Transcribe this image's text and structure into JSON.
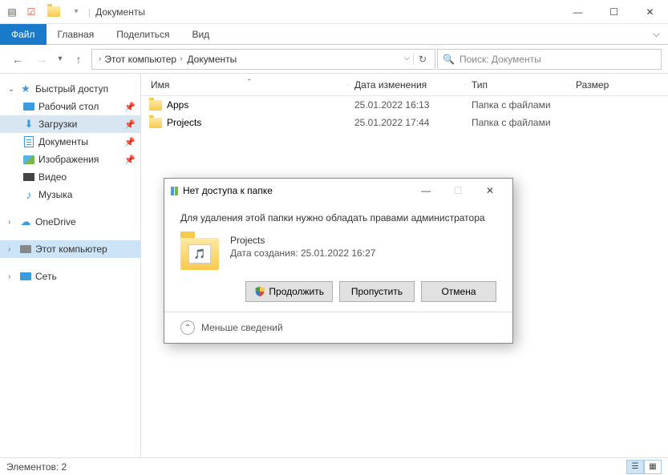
{
  "window": {
    "title": "Документы",
    "min": "—",
    "max": "☐",
    "close": "✕"
  },
  "ribbon": {
    "file": "Файл",
    "tabs": [
      "Главная",
      "Поделиться",
      "Вид"
    ]
  },
  "nav": {
    "this_pc": "Этот компьютер",
    "folder": "Документы",
    "search_placeholder": "Поиск: Документы"
  },
  "sidebar": {
    "quick": "Быстрый доступ",
    "items": [
      {
        "label": "Рабочий стол",
        "pinned": true
      },
      {
        "label": "Загрузки",
        "pinned": true,
        "selected": true
      },
      {
        "label": "Документы",
        "pinned": true
      },
      {
        "label": "Изображения",
        "pinned": true
      },
      {
        "label": "Видео"
      },
      {
        "label": "Музыка"
      }
    ],
    "onedrive": "OneDrive",
    "thispc": "Этот компьютер",
    "network": "Сеть"
  },
  "columns": {
    "name": "Имя",
    "date": "Дата изменения",
    "type": "Тип",
    "size": "Размер"
  },
  "files": [
    {
      "name": "Apps",
      "date": "25.01.2022 16:13",
      "type": "Папка с файлами"
    },
    {
      "name": "Projects",
      "date": "25.01.2022 17:44",
      "type": "Папка с файлами"
    }
  ],
  "status": {
    "count": "Элементов: 2"
  },
  "dialog": {
    "title": "Нет доступа к папке",
    "message": "Для удаления этой папки нужно обладать правами администратора",
    "item_name": "Projects",
    "item_date": "Дата создания: 25.01.2022 16:27",
    "btn_continue": "Продолжить",
    "btn_skip": "Пропустить",
    "btn_cancel": "Отмена",
    "less_info": "Меньше сведений"
  }
}
